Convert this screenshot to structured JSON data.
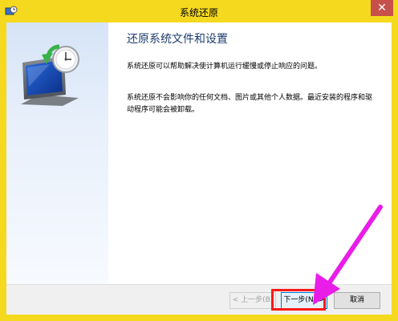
{
  "window": {
    "title": "系统还原",
    "close_glyph": "✕"
  },
  "page": {
    "heading": "还原系统文件和设置",
    "paragraph1": "系统还原可以帮助解决使计算机运行缓慢或停止响应的问题。",
    "paragraph2": "系统还原不会影响你的任何文档、图片或其他个人数据。最近安装的程序和驱动程序可能会被卸载。"
  },
  "buttons": {
    "back_label": "< 上一步(B)",
    "next_label": "下一步(N) >",
    "cancel_label": "取消"
  },
  "colors": {
    "frame": "#f5d91e",
    "close": "#c7504a",
    "annotation_box": "#ff1818",
    "annotation_arrow": "#e91ce8"
  },
  "icons": {
    "app": "system-restore-icon",
    "hero": "monitor-clock-restore-icon"
  }
}
